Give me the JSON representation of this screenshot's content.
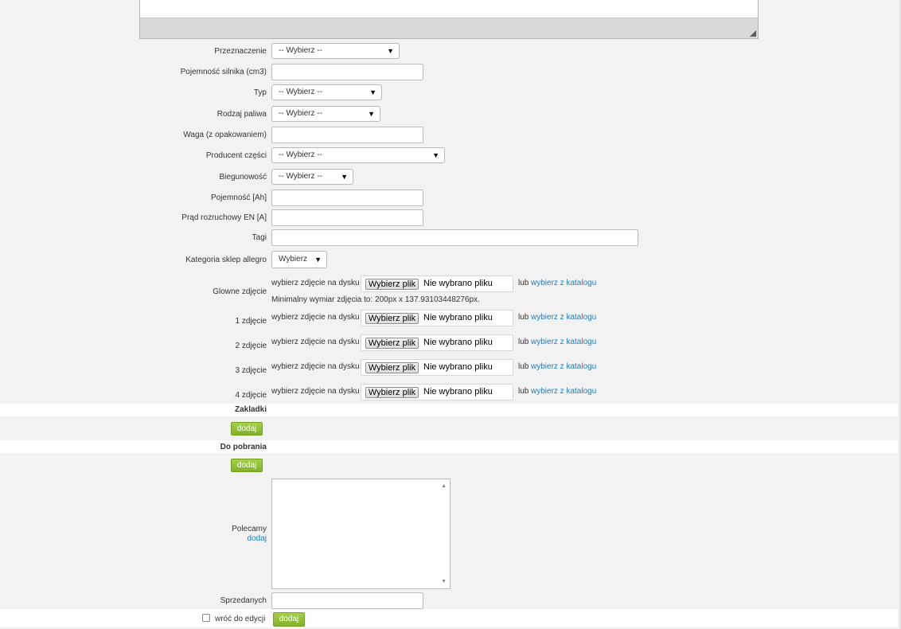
{
  "form": {
    "przeznaczenie": {
      "label": "Przeznaczenie",
      "value": "-- Wybierz --"
    },
    "pojemnosc_silnika": {
      "label": "Pojemność silnika (cm3)",
      "value": ""
    },
    "typ": {
      "label": "Typ",
      "value": "-- Wybierz --"
    },
    "rodzaj_paliwa": {
      "label": "Rodzaj paliwa",
      "value": "-- Wybierz --"
    },
    "waga": {
      "label": "Waga (z opakowaniem)",
      "value": ""
    },
    "producent": {
      "label": "Producent części",
      "value": "-- Wybierz --"
    },
    "biegunowosc": {
      "label": "Biegunowość",
      "value": "-- Wybierz --"
    },
    "pojemnosc_ah": {
      "label": "Pojemność [Ah]",
      "value": ""
    },
    "prad": {
      "label": "Prąd rozruchowy EN [A]",
      "value": ""
    },
    "tagi": {
      "label": "Tagi",
      "value": ""
    },
    "kategoria": {
      "label": "Kategoria sklep allegro",
      "value": "Wybierz"
    }
  },
  "images": {
    "disk_text": "wybierz zdjęcie na dysku",
    "file_button": "Wybierz plik",
    "no_file": "Nie wybrano pliku",
    "or_text": "lub",
    "catalog_link": "wybierz z katalogu",
    "min_size_hint": "Minimalny wymiar zdjęcia to: 200px x 137.93103448276px.",
    "rows": [
      {
        "label": "Glowne zdjęcie"
      },
      {
        "label": "1 zdjęcie"
      },
      {
        "label": "2 zdjęcie"
      },
      {
        "label": "3 zdjęcie"
      },
      {
        "label": "4 zdjęcie"
      }
    ]
  },
  "sections": {
    "zakladki": "Zakladki",
    "do_pobrania": "Do pobrania",
    "add_label": "dodaj"
  },
  "polecamy": {
    "label": "Polecamy",
    "add_link": "dodaj"
  },
  "sprzedanych": {
    "label": "Sprzedanych",
    "value": ""
  },
  "footer": {
    "back_to_edit": "wróć do edycji",
    "submit": "dodaj"
  },
  "icons": {
    "dropdown": "triangle-down-icon",
    "resize": "resize-grip-icon"
  },
  "colors": {
    "link": "#1a7fc1",
    "button_green": "#8bb832",
    "background": "#f2f2f2"
  }
}
